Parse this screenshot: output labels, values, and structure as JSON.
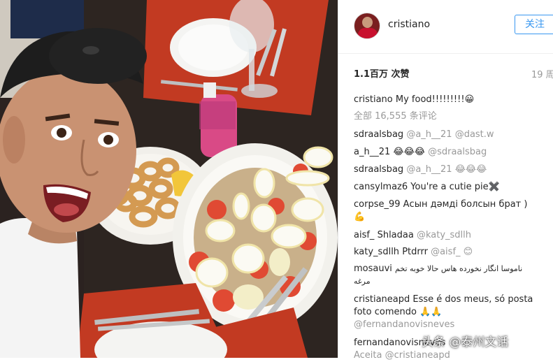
{
  "post": {
    "username": "cristiano",
    "follow_label": "关注",
    "likes": "1.1百万 次赞",
    "time": "19 周",
    "caption_user": "cristiano",
    "caption_text": "My food!!!!!!!!!😀",
    "view_all": "全部 16,555 条评论"
  },
  "comments": [
    {
      "user": "sdraalsbag",
      "text": "",
      "mention": "@a_h__21 @dast.w"
    },
    {
      "user": "a_h__21",
      "text": "😂😂😂 ",
      "mention": "@sdraalsbag"
    },
    {
      "user": "sdraalsbag",
      "text": "",
      "mention": "@a_h__21 😂😂😂"
    },
    {
      "user": "cansylmaz6",
      "text": "You're a cutie pie✖️",
      "mention": ""
    },
    {
      "user": "corpse_99",
      "text": "Асын дəмді болсын брат )",
      "mention": ""
    },
    {
      "user": "",
      "text": "💪",
      "mention": ""
    },
    {
      "user": "aisf_",
      "text": "Shladaa ",
      "mention": "@katy_sdllh"
    },
    {
      "user": "katy_sdllh",
      "text": "Ptdrrr ",
      "mention": "@aisf_ 😊"
    },
    {
      "user": "mosauvi",
      "text": "ناموسا انگار نخورده هاس حالا خوبه تخم",
      "mention": ""
    },
    {
      "user": "",
      "text": "مرغه",
      "mention": ""
    },
    {
      "user": "cristianeapd",
      "text": "Esse é dos meus, só posta",
      "mention": ""
    },
    {
      "user": "",
      "text": "foto comendo 🙏🙏",
      "mention": ""
    },
    {
      "user": "",
      "text": "",
      "mention": "@fernandanovisneves"
    },
    {
      "user": "fernandanovisneves",
      "text": "",
      "mention": ""
    },
    {
      "user": "",
      "text": "Aceita @cristianeapd",
      "mention": ""
    }
  ],
  "watermark": "头条 @泰州文话",
  "colors": {
    "accent": "#3897f0",
    "muted": "#999999",
    "text": "#262626",
    "mat": "#c8402a"
  },
  "icons": [
    "avatar-icon"
  ]
}
